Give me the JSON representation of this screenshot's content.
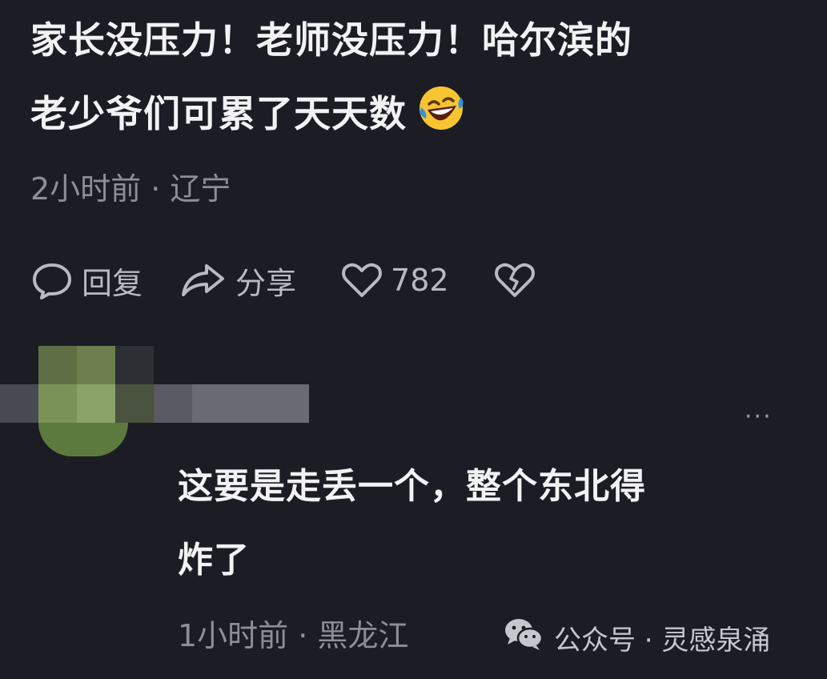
{
  "comment1": {
    "line1": "家长没压力！老师没压力！哈尔滨的",
    "line2": "老少爷们可累了天天数",
    "emoji": "rolling-on-floor-laughing",
    "meta": "2小时前 · 辽宁",
    "actions": {
      "reply_label": "回复",
      "share_label": "分享",
      "like_count": "782"
    }
  },
  "comment2": {
    "more_menu": "···",
    "line1": "这要是走丢一个，整个东北得",
    "line2": "炸了",
    "meta": "1小时前 · 黑龙江"
  },
  "watermark": {
    "text": "公众号 · 灵感泉涌",
    "icon": "wechat-icon"
  },
  "colors": {
    "background": "#1b1c24",
    "text": "#f2f2f4",
    "meta": "#8d8e96"
  }
}
